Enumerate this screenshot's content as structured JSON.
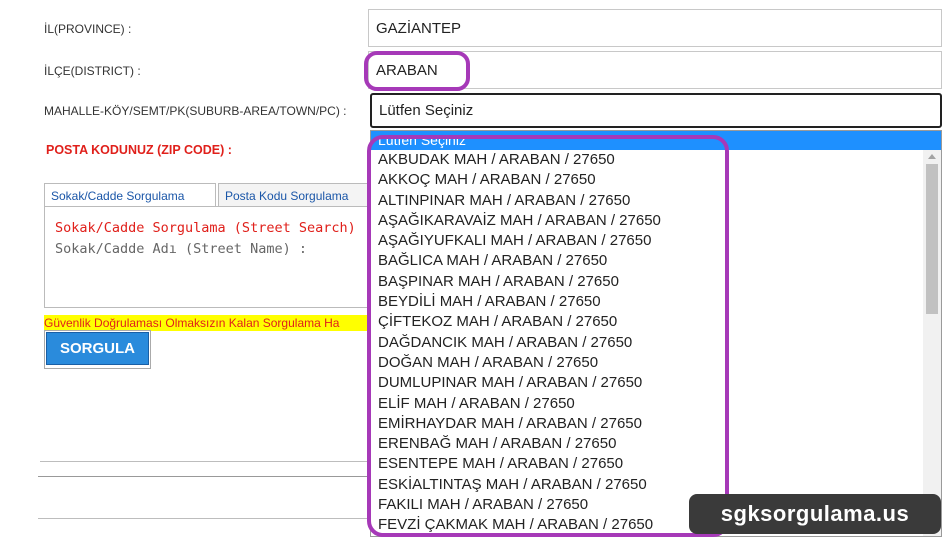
{
  "form": {
    "province_label": "İL(PROVINCE) :",
    "province_value": "GAZİANTEP",
    "district_label": "İLÇE(DISTRICT) :",
    "district_value": "ARABAN",
    "suburb_label": "MAHALLE-KÖY/SEMT/PK(SUBURB-AREA/TOWN/PC) :",
    "suburb_value": "Lütfen Seçiniz",
    "zip_label": "POSTA KODUNUZ (ZIP CODE) :"
  },
  "tabs": [
    {
      "label": "Sokak/Cadde Sorgulama"
    },
    {
      "label": "Posta Kodu Sorgulama"
    }
  ],
  "panel": {
    "title": "Sokak/Cadde Sorgulama (Street Search)",
    "field_label": "Sokak/Cadde Adı (Street Name) :"
  },
  "warning": "Güvenlik Doğrulaması Olmaksızın Kalan Sorgulama Ha",
  "query_button": "SORGULA",
  "dropdown": {
    "header": "Lütfen Seçiniz",
    "options": [
      "AKBUDAK MAH / ARABAN / 27650",
      "AKKOÇ MAH / ARABAN / 27650",
      "ALTINPINAR MAH / ARABAN / 27650",
      "AŞAĞIKARAVAİZ MAH / ARABAN / 27650",
      "AŞAĞIYUFKALI MAH / ARABAN / 27650",
      "BAĞLICA MAH / ARABAN / 27650",
      "BAŞPINAR MAH / ARABAN / 27650",
      "BEYDİLİ MAH / ARABAN / 27650",
      "ÇİFTEKOZ MAH / ARABAN / 27650",
      "DAĞDANCIK MAH / ARABAN / 27650",
      "DOĞAN MAH / ARABAN / 27650",
      "DUMLUPINAR MAH / ARABAN / 27650",
      "ELİF MAH / ARABAN / 27650",
      "EMİRHAYDAR MAH / ARABAN / 27650",
      "ERENBAĞ MAH / ARABAN / 27650",
      "ESENTEPE MAH / ARABAN / 27650",
      "ESKİALTINTAŞ MAH / ARABAN / 27650",
      "FAKILI MAH / ARABAN / 27650",
      "FEVZİ ÇAKMAK MAH / ARABAN / 27650"
    ]
  },
  "watermark": "sgksorgulama.us",
  "colors": {
    "highlight": "#a639b8",
    "zip_label": "#e0201b",
    "warning_bg": "#ffff00",
    "warning_text": "#e0201b",
    "dropdown_selected": "#1e90ff",
    "button": "#2a8bdc"
  }
}
